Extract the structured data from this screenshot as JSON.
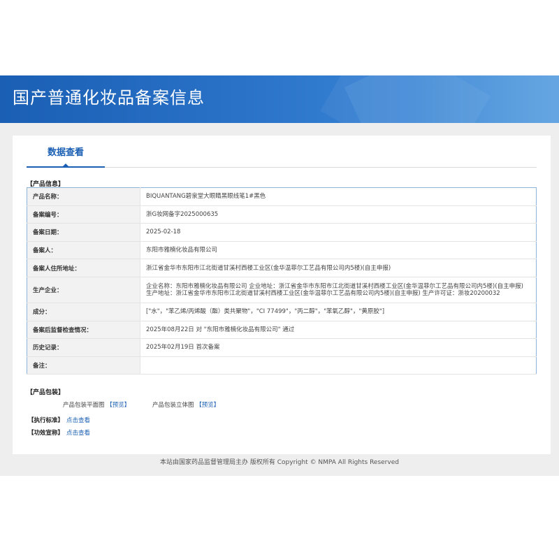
{
  "header": {
    "title": "国产普通化妆品备案信息"
  },
  "tabs": [
    {
      "label": "数据查看",
      "active": true
    }
  ],
  "product_info": {
    "section_title": "【产品信息】",
    "rows": [
      {
        "label": "产品名称：",
        "value": "BIQUANTANG碧泉堂大眼睛黑眼线笔1#黑色"
      },
      {
        "label": "备案编号：",
        "value": "浙G妆网备字2025000635"
      },
      {
        "label": "备案日期：",
        "value": "2025-02-18"
      },
      {
        "label": "备案人：",
        "value": "东阳市雅楠化妆品有限公司"
      },
      {
        "label": "备案人住所地址：",
        "value": "浙江省金华市东阳市江北街道甘溪村西楼工业区(金华温菲尔工艺品有限公司内5楼)(自主申报)"
      },
      {
        "label": "生产企业：",
        "value": "企业名称：东阳市雅楠化妆品有限公司 企业地址：浙江省金华市东阳市江北街道甘溪村西楼工业区(金华温菲尔工艺品有限公司内5楼)(自主申报) 生产地址：浙江省金华市东阳市江北街道甘溪村西楼工业区(金华温菲尔工艺品有限公司内5楼)(自主申报) 生产许可证：浙妆20200032"
      },
      {
        "label": "成分：",
        "value": "[\"水\"，\"苯乙烯/丙烯酸（酯）类共聚物\"，\"CI 77499\"，\"丙二醇\"，\"苯氧乙醇\"，\"黄原胶\"]"
      },
      {
        "label": "备案后监督检查情况：",
        "value": "2025年08月22日 对 \"东阳市雅楠化妆品有限公司\" 通过"
      },
      {
        "label": "历史记录：",
        "value": "2025年02月19日 首次备案"
      },
      {
        "label": "备注：",
        "value": ""
      }
    ]
  },
  "packaging": {
    "section_title": "【产品包装】",
    "flat_label": "产品包装平面图",
    "flat_link": "【预览】",
    "solid_label": "产品包装立体图",
    "solid_link": "【预览】"
  },
  "standards": {
    "label": "【执行标准】",
    "link": "点击查看"
  },
  "efficacy": {
    "label": "【功效宣称】",
    "link": "点击查看"
  },
  "footer": {
    "text": "本站由国家药品监督管理局主办 版权所有 Copyright © NMPA All Rights Reserved"
  },
  "colors": {
    "primary": "#1a5fb4",
    "table_border": "#8eb3db",
    "label_bg": "#f2f2f2",
    "page_bg": "#eeeeee"
  }
}
